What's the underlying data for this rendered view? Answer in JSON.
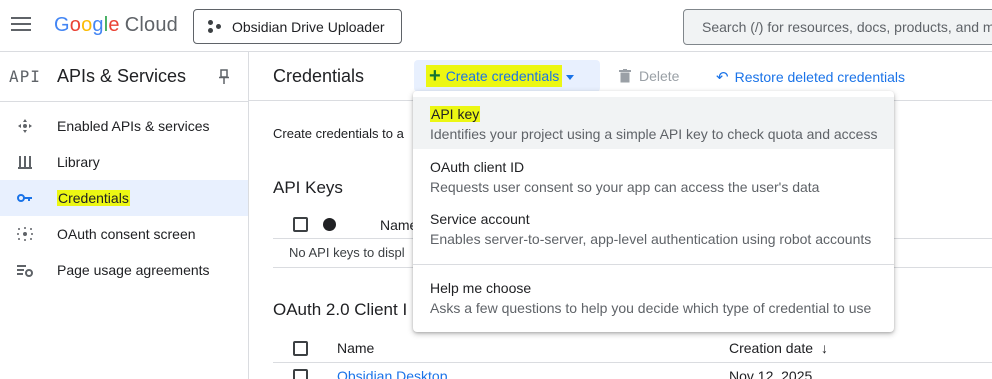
{
  "topbar": {
    "logo_google": "Google",
    "logo_cloud": "Cloud",
    "project_name": "Obsidian Drive Uploader",
    "search_placeholder": "Search (/) for resources, docs, products, and m"
  },
  "sidebar": {
    "api_logo": "API",
    "title": "APIs & Services",
    "items": [
      {
        "label": "Enabled APIs & services",
        "icon": "hub-icon"
      },
      {
        "label": "Library",
        "icon": "library-icon"
      },
      {
        "label": "Credentials",
        "icon": "key-icon",
        "active": true
      },
      {
        "label": "OAuth consent screen",
        "icon": "consent-icon"
      },
      {
        "label": "Page usage agreements",
        "icon": "agreements-icon"
      }
    ]
  },
  "toolbar": {
    "page_title": "Credentials",
    "create_label": "Create credentials",
    "delete_label": "Delete",
    "restore_label": "Restore deleted credentials"
  },
  "main": {
    "intro": "Create credentials to a",
    "api_keys_title": "API Keys",
    "api_keys_col_name": "Name",
    "api_keys_empty": "No API keys to displ",
    "oauth_title": "OAuth 2.0 Client I",
    "oauth_col_name": "Name",
    "oauth_col_created": "Creation date",
    "oauth_rows": [
      {
        "name": "Obsidian Desktop",
        "created": "Nov 12, 2025"
      }
    ]
  },
  "menu": {
    "items": [
      {
        "title": "API key",
        "desc": "Identifies your project using a simple API key to check quota and access"
      },
      {
        "title": "OAuth client ID",
        "desc": "Requests user consent so your app can access the user's data"
      },
      {
        "title": "Service account",
        "desc": "Enables server-to-server, app-level authentication using robot accounts"
      },
      {
        "title": "Help me choose",
        "desc": "Asks a few questions to help you decide which type of credential to use"
      }
    ]
  },
  "colors": {
    "accent": "#1a73e8",
    "highlight": "#ecf713",
    "active_nav_bg": "#e8f0fe"
  }
}
